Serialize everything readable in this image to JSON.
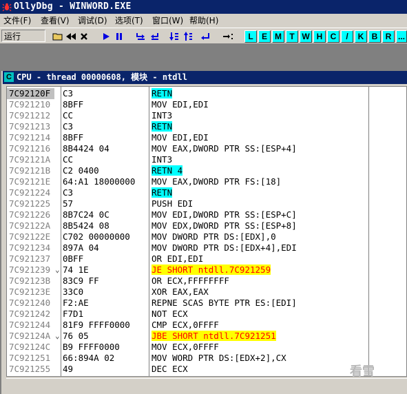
{
  "window": {
    "title": "OllyDbg - WINWORD.EXE",
    "icon": "bug-icon"
  },
  "menu": [
    "文件(F)",
    "查看(V)",
    "调试(D)",
    "选项(T)",
    "窗口(W)",
    "帮助(H)"
  ],
  "toolbar": {
    "status": "运行",
    "buttons": [
      {
        "name": "open-icon",
        "glyph": "📂"
      },
      {
        "name": "restart-icon",
        "glyph": "◀◀"
      },
      {
        "name": "close-icon",
        "glyph": "✕"
      },
      {
        "name": "run-icon",
        "glyph": "▶"
      },
      {
        "name": "pause-icon",
        "glyph": "❚❚"
      },
      {
        "name": "step-into-icon",
        "glyph": "⇲"
      },
      {
        "name": "step-over-icon",
        "glyph": "⇳"
      },
      {
        "name": "trace-into-icon",
        "glyph": "⇊"
      },
      {
        "name": "trace-over-icon",
        "glyph": "⇅"
      },
      {
        "name": "execute-till-return-icon",
        "glyph": "↪"
      },
      {
        "name": "go-to-address-icon",
        "glyph": "→:"
      }
    ],
    "letters": [
      "L",
      "E",
      "M",
      "T",
      "W",
      "H",
      "C",
      "/",
      "K",
      "B",
      "R",
      "..."
    ]
  },
  "cpu_window": {
    "icon_letter": "C",
    "title": "CPU - thread 00000608, 模块 - ntdll"
  },
  "rows": [
    {
      "addr": "7C92120F",
      "jmp": "",
      "hex": "C3",
      "instr": "RETN",
      "hl": "ret",
      "current": true
    },
    {
      "addr": "7C921210",
      "jmp": "",
      "hex": "8BFF",
      "instr": "MOV EDI,EDI",
      "hl": ""
    },
    {
      "addr": "7C921212",
      "jmp": "",
      "hex": "CC",
      "instr": "INT3",
      "hl": ""
    },
    {
      "addr": "7C921213",
      "jmp": "",
      "hex": "C3",
      "instr": "RETN",
      "hl": "ret"
    },
    {
      "addr": "7C921214",
      "jmp": "",
      "hex": "8BFF",
      "instr": "MOV EDI,EDI",
      "hl": ""
    },
    {
      "addr": "7C921216",
      "jmp": "",
      "hex": "8B4424 04",
      "instr": "MOV EAX,DWORD PTR SS:[ESP+4]",
      "hl": ""
    },
    {
      "addr": "7C92121A",
      "jmp": "",
      "hex": "CC",
      "instr": "INT3",
      "hl": ""
    },
    {
      "addr": "7C92121B",
      "jmp": "",
      "hex": "C2 0400",
      "instr": "RETN 4",
      "hl": "ret"
    },
    {
      "addr": "7C92121E",
      "jmp": "",
      "hex": "64:A1 18000000",
      "instr": "MOV EAX,DWORD PTR FS:[18]",
      "hl": ""
    },
    {
      "addr": "7C921224",
      "jmp": "",
      "hex": "C3",
      "instr": "RETN",
      "hl": "ret"
    },
    {
      "addr": "7C921225",
      "jmp": "",
      "hex": "57",
      "instr": "PUSH EDI",
      "hl": ""
    },
    {
      "addr": "7C921226",
      "jmp": "",
      "hex": "8B7C24 0C",
      "instr": "MOV EDI,DWORD PTR SS:[ESP+C]",
      "hl": ""
    },
    {
      "addr": "7C92122A",
      "jmp": "",
      "hex": "8B5424 08",
      "instr": "MOV EDX,DWORD PTR SS:[ESP+8]",
      "hl": ""
    },
    {
      "addr": "7C92122E",
      "jmp": "",
      "hex": "C702 00000000",
      "instr": "MOV DWORD PTR DS:[EDX],0",
      "hl": ""
    },
    {
      "addr": "7C921234",
      "jmp": "",
      "hex": "897A 04",
      "instr": "MOV DWORD PTR DS:[EDX+4],EDI",
      "hl": ""
    },
    {
      "addr": "7C921237",
      "jmp": "",
      "hex": "0BFF",
      "instr": "OR EDI,EDI",
      "hl": ""
    },
    {
      "addr": "7C921239",
      "jmp": "⌄",
      "hex": "74 1E",
      "instr": "JE SHORT ntdll.7C921259",
      "hl": "jmp"
    },
    {
      "addr": "7C92123B",
      "jmp": "",
      "hex": "83C9 FF",
      "instr": "OR ECX,FFFFFFFF",
      "hl": ""
    },
    {
      "addr": "7C92123E",
      "jmp": "",
      "hex": "33C0",
      "instr": "XOR EAX,EAX",
      "hl": ""
    },
    {
      "addr": "7C921240",
      "jmp": "",
      "hex": "F2:AE",
      "instr": "REPNE SCAS BYTE PTR ES:[EDI]",
      "hl": ""
    },
    {
      "addr": "7C921242",
      "jmp": "",
      "hex": "F7D1",
      "instr": "NOT ECX",
      "hl": ""
    },
    {
      "addr": "7C921244",
      "jmp": "",
      "hex": "81F9 FFFF0000",
      "instr": "CMP ECX,0FFFF",
      "hl": ""
    },
    {
      "addr": "7C92124A",
      "jmp": "⌄",
      "hex": "76 05",
      "instr": "JBE SHORT ntdll.7C921251",
      "hl": "jmp"
    },
    {
      "addr": "7C92124C",
      "jmp": "",
      "hex": "B9 FFFF0000",
      "instr": "MOV ECX,0FFFF",
      "hl": ""
    },
    {
      "addr": "7C921251",
      "jmp": "",
      "hex": "66:894A 02",
      "instr": "MOV WORD PTR DS:[EDX+2],CX",
      "hl": ""
    },
    {
      "addr": "7C921255",
      "jmp": "",
      "hex": "49",
      "instr": "DEC ECX",
      "hl": ""
    }
  ],
  "watermark": "看雪"
}
